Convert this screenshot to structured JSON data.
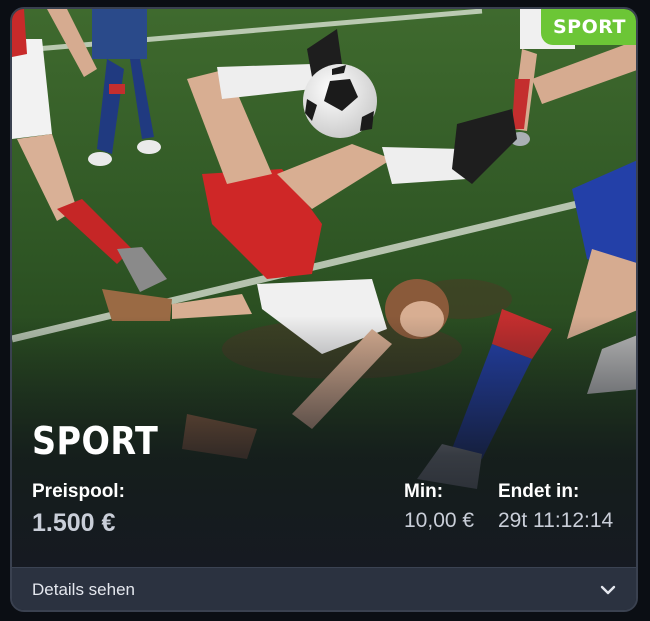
{
  "card": {
    "badge": "SPORT",
    "title": "SPORT",
    "prize_pool_label": "Preispool:",
    "prize_pool_value": "1.500 €",
    "min_label": "Min:",
    "min_value": "10,00 €",
    "ends_label": "Endet in:",
    "ends_value": "29t 11:12:14",
    "details_label": "Details sehen",
    "details_icon": "chevron-down-icon"
  },
  "colors": {
    "badge": "#6cc636",
    "footer": "#2b3240",
    "card_border": "#3a4150"
  }
}
